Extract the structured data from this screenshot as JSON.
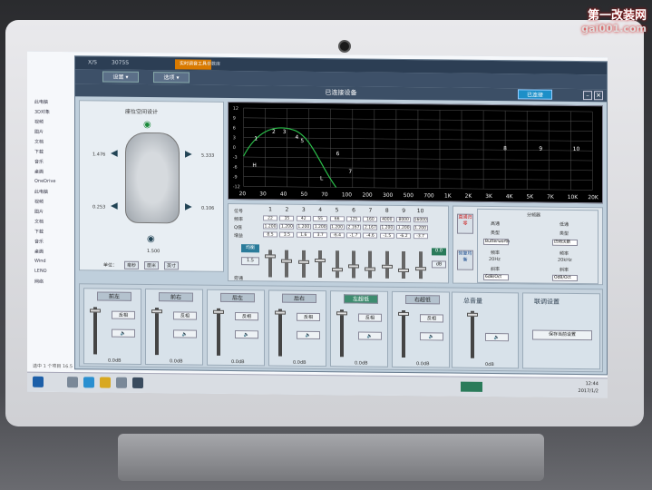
{
  "watermark": {
    "line1": "第一改装网",
    "line2": "gai001.com"
  },
  "explorer": {
    "sidebar": [
      "此电脑",
      "3D对象",
      "视频",
      "图片",
      "文档",
      "下载",
      "音乐",
      "桌面",
      "OneDrive",
      "此电脑",
      "视频",
      "图片",
      "文档",
      "下载",
      "音乐",
      "桌面",
      "Wind",
      "LENO",
      "网络"
    ],
    "status": "选中 1 个项目  16.5 MB"
  },
  "taskbar": {
    "time": "12:44",
    "date": "2017/1/2"
  },
  "app": {
    "title_left": "X/S",
    "title_model": "3075S",
    "tabs": [
      "实时调音工具",
      "参数库"
    ],
    "menu": [
      "设置",
      "选项"
    ],
    "status": "已连接设备",
    "connected_btn": "已连接",
    "car_panel": {
      "title": "座位空间设计",
      "delays": {
        "fl": "1.476",
        "fr": "5.333",
        "rl": "0.253",
        "rr": "0.106",
        "sub": "1.500"
      },
      "unit_label": "单位：",
      "units": [
        "毫秒",
        "厘米",
        "英寸"
      ]
    },
    "eq_graph": {
      "x_ticks": [
        "20",
        "30",
        "40",
        "50",
        "70",
        "100",
        "200",
        "300",
        "500",
        "700",
        "1K",
        "2K",
        "3K",
        "4K",
        "5K",
        "7K",
        "10K",
        "20K"
      ],
      "y_ticks": [
        "12",
        "9",
        "6",
        "3",
        "0",
        "-3",
        "-6",
        "-9",
        "-12"
      ],
      "markers": [
        "1",
        "2",
        "3",
        "4",
        "5",
        "6",
        "7",
        "8",
        "9",
        "10",
        "H",
        "L"
      ]
    },
    "params": {
      "row_labels": [
        "位号",
        "频率",
        "Q值",
        "增益"
      ],
      "channels": [
        "1",
        "2",
        "3",
        "4",
        "5",
        "6",
        "7",
        "8",
        "9",
        "10"
      ],
      "freq": [
        "22",
        "35",
        "42",
        "55",
        "66",
        "125",
        "160",
        "4000",
        "8000",
        "16000"
      ],
      "q": [
        "1.200",
        "1.200",
        "1.200",
        "1.200",
        "1.200",
        "2.167",
        "2.167",
        "1.200",
        "1.200",
        "1.200"
      ],
      "gain": [
        "8.5",
        "3.5",
        "1.6",
        "3.7",
        "-6.4",
        "-1.7",
        "-4.6",
        "-1.5",
        "-6.2",
        "-3.7"
      ],
      "left_btns": [
        "均衡",
        "1.5"
      ],
      "bottom_label": "旁通",
      "right_btns": [
        "0.0",
        "dB"
      ]
    },
    "side": {
      "reset": "直通归零",
      "restore": "恢复均衡",
      "xover_title": "分频器",
      "hp": "高通",
      "lp": "低通",
      "type_label": "类型",
      "type_hp": "Butterworth",
      "type_lp": "巴特沃斯",
      "freq_label": "频率",
      "freq_hp": "20Hz",
      "freq_lp": "20kHz",
      "slope_label": "斜率",
      "slope_hp": "6dB/Oct",
      "slope_lp": "OdB/Oct"
    },
    "channels_bottom": [
      {
        "name": "前左",
        "active": false
      },
      {
        "name": "前右",
        "active": false
      },
      {
        "name": "后左",
        "active": false
      },
      {
        "name": "后右",
        "active": false
      },
      {
        "name": "左超低",
        "active": true
      },
      {
        "name": "右超低",
        "active": false
      }
    ],
    "bottom_labels": {
      "phase": "反相",
      "mute": "🔈",
      "db": "0.0dB"
    },
    "master": {
      "title": "总音量",
      "db": "0dB"
    },
    "debug": {
      "title": "联调设置",
      "btn": "保存当前设置"
    }
  }
}
